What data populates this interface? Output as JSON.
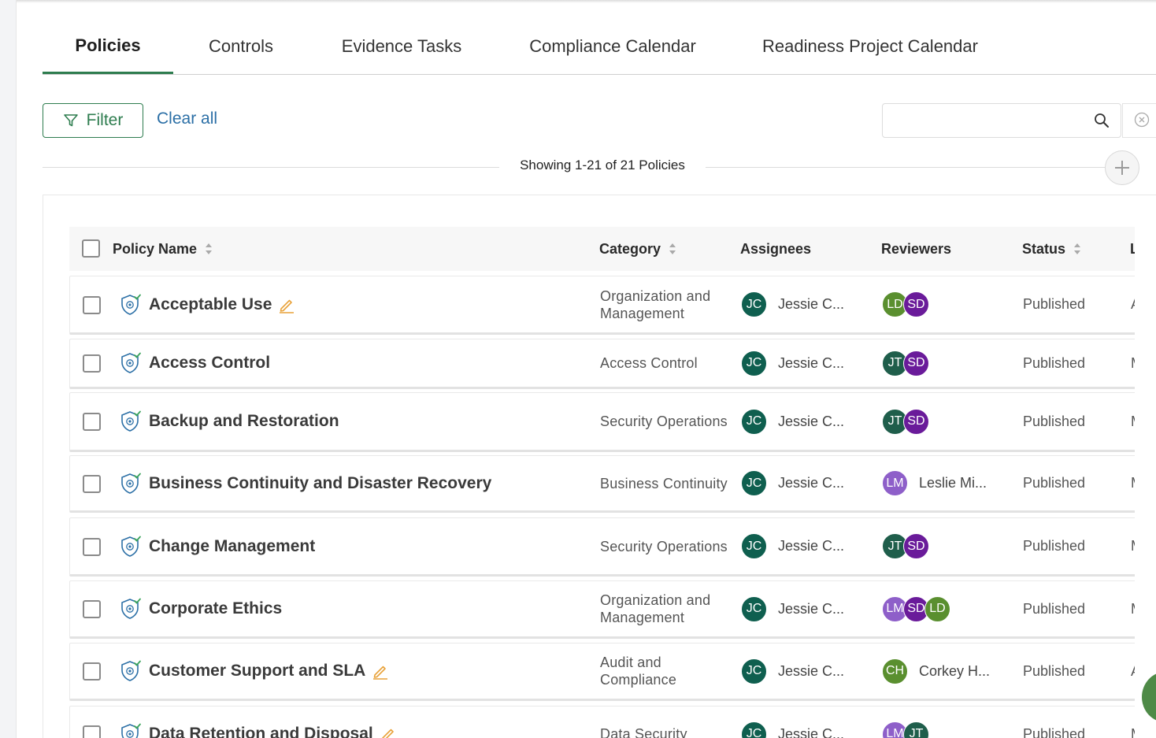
{
  "tabs": [
    {
      "label": "Policies",
      "active": true
    },
    {
      "label": "Controls"
    },
    {
      "label": "Evidence Tasks"
    },
    {
      "label": "Compliance Calendar"
    },
    {
      "label": "Readiness Project Calendar"
    }
  ],
  "toolbar": {
    "filter_label": "Filter",
    "clear_all_label": "Clear all",
    "search_value": "",
    "search_placeholder": ""
  },
  "summary": {
    "showing_text": "Showing 1-21 of 21 Policies"
  },
  "table": {
    "headers": {
      "policy_name": "Policy Name",
      "category": "Category",
      "assignees": "Assignees",
      "reviewers": "Reviewers",
      "status": "Status",
      "extra": "L"
    },
    "rows": [
      {
        "name": "Acceptable Use",
        "editable": true,
        "category": "Organization and Management",
        "assignee_initials": "JC",
        "assignee_name": "Jessie C...",
        "reviewers": [
          {
            "initials": "LD",
            "color": "#5a8f2f"
          },
          {
            "initials": "SD",
            "color": "#6a1b9a"
          }
        ],
        "reviewer_name": "",
        "status": "Published",
        "extra": "A"
      },
      {
        "name": "Access Control",
        "editable": false,
        "category": "Access Control",
        "assignee_initials": "JC",
        "assignee_name": "Jessie C...",
        "reviewers": [
          {
            "initials": "JT",
            "color": "#1f5e4b"
          },
          {
            "initials": "SD",
            "color": "#6a1b9a"
          }
        ],
        "reviewer_name": "",
        "status": "Published",
        "extra": "M"
      },
      {
        "name": "Backup and Restoration",
        "editable": false,
        "category": "Security Operations",
        "assignee_initials": "JC",
        "assignee_name": "Jessie C...",
        "reviewers": [
          {
            "initials": "JT",
            "color": "#1f5e4b"
          },
          {
            "initials": "SD",
            "color": "#6a1b9a"
          }
        ],
        "reviewer_name": "",
        "status": "Published",
        "extra": "M"
      },
      {
        "name": "Business Continuity and Disaster Recovery",
        "editable": false,
        "category": "Business Continuity",
        "assignee_initials": "JC",
        "assignee_name": "Jessie C...",
        "reviewers": [
          {
            "initials": "LM",
            "color": "#8e5fc9"
          }
        ],
        "reviewer_name": "Leslie Mi...",
        "status": "Published",
        "extra": "M"
      },
      {
        "name": "Change Management",
        "editable": false,
        "category": "Security Operations",
        "assignee_initials": "JC",
        "assignee_name": "Jessie C...",
        "reviewers": [
          {
            "initials": "JT",
            "color": "#1f5e4b"
          },
          {
            "initials": "SD",
            "color": "#6a1b9a"
          }
        ],
        "reviewer_name": "",
        "status": "Published",
        "extra": "M"
      },
      {
        "name": "Corporate Ethics",
        "editable": false,
        "category": "Organization and Management",
        "assignee_initials": "JC",
        "assignee_name": "Jessie C...",
        "reviewers": [
          {
            "initials": "LM",
            "color": "#8e5fc9"
          },
          {
            "initials": "SD",
            "color": "#6a1b9a"
          },
          {
            "initials": "LD",
            "color": "#5a8f2f"
          }
        ],
        "reviewer_name": "",
        "status": "Published",
        "extra": "M"
      },
      {
        "name": "Customer Support and SLA",
        "editable": true,
        "category": "Audit and Compliance",
        "assignee_initials": "JC",
        "assignee_name": "Jessie C...",
        "reviewers": [
          {
            "initials": "CH",
            "color": "#5a8f2f"
          }
        ],
        "reviewer_name": "Corkey H...",
        "status": "Published",
        "extra": "A"
      },
      {
        "name": "Data Retention and Disposal",
        "editable": true,
        "category": "Data Security",
        "assignee_initials": "JC",
        "assignee_name": "Jessie C...",
        "reviewers": [
          {
            "initials": "LM",
            "color": "#8e5fc9"
          },
          {
            "initials": "JT",
            "color": "#1f5e4b"
          }
        ],
        "reviewer_name": "",
        "status": "Published",
        "extra": "M"
      }
    ]
  },
  "colors": {
    "accent": "#2e7d4f",
    "link": "#2b6fa6",
    "assignee_avatar": "#0f5f4f",
    "pencil": "#e8a23a",
    "shield": "#2b6fa6"
  }
}
